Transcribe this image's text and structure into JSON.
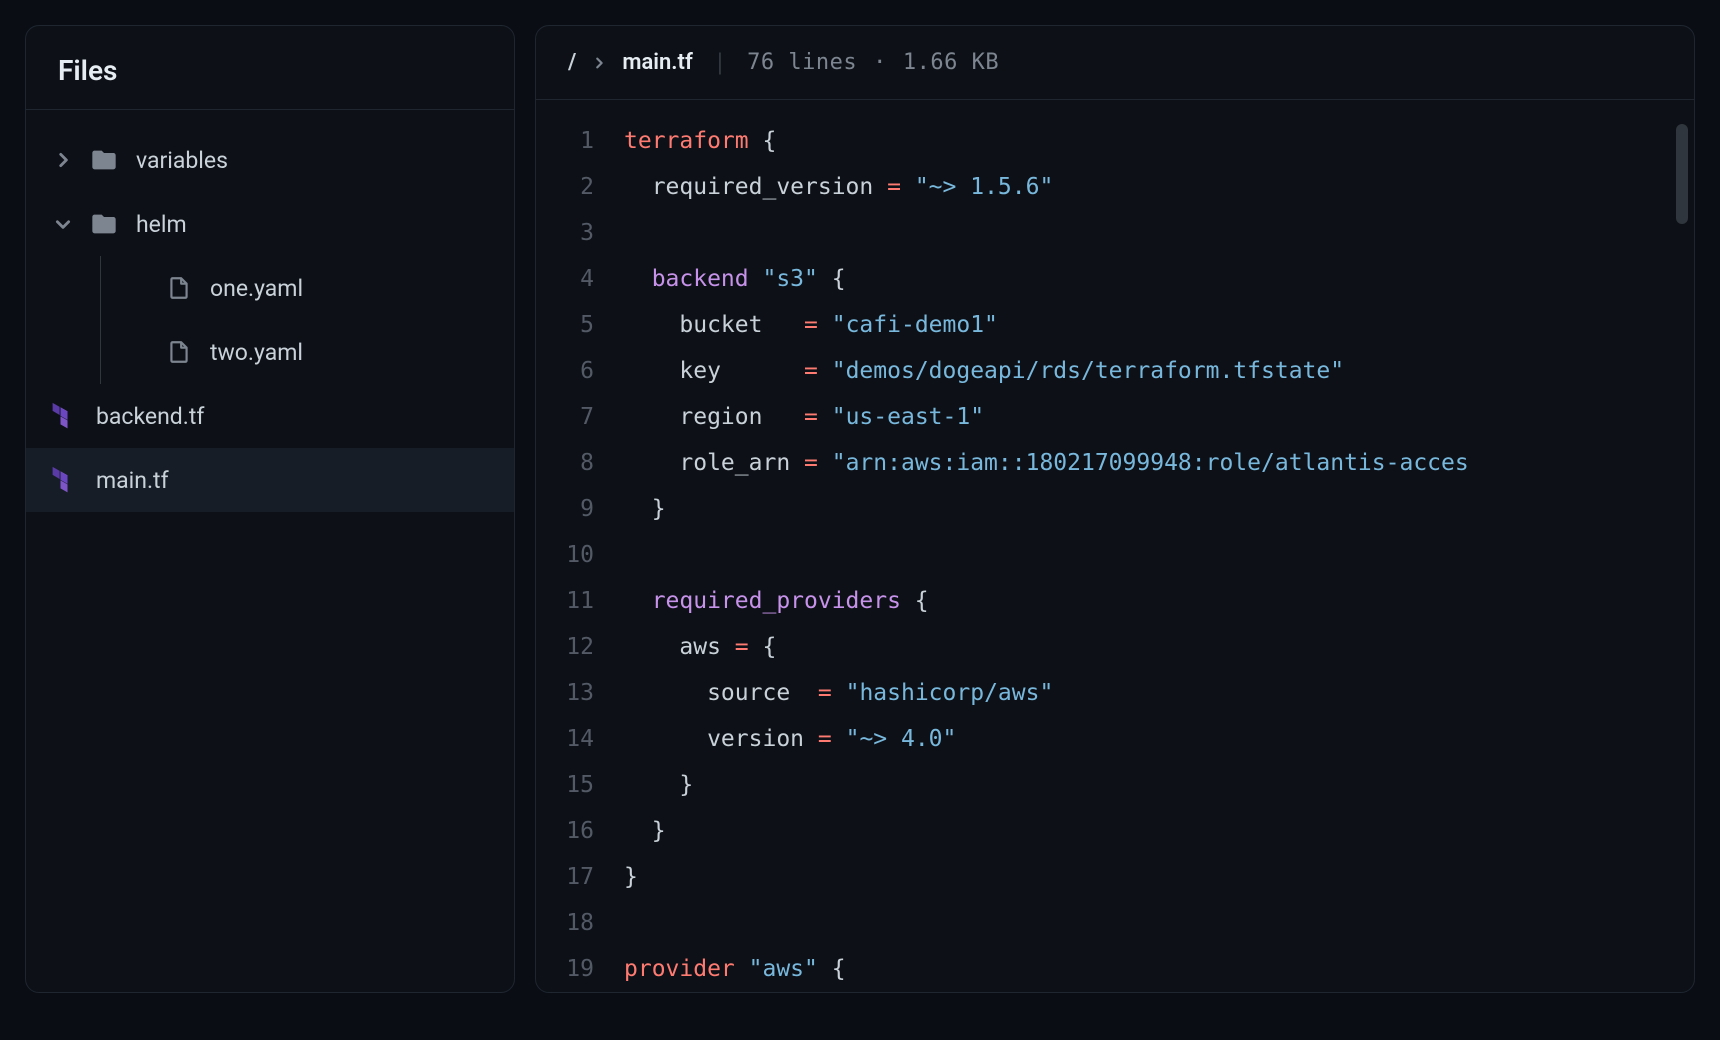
{
  "sidebar": {
    "title": "Files",
    "tree": [
      {
        "type": "folder",
        "name": "variables",
        "expanded": false,
        "indent": 0
      },
      {
        "type": "folder",
        "name": "helm",
        "expanded": true,
        "indent": 0
      },
      {
        "type": "file",
        "name": "one.yaml",
        "icon": "file",
        "indent": 2
      },
      {
        "type": "file",
        "name": "two.yaml",
        "icon": "file",
        "indent": 2
      },
      {
        "type": "file",
        "name": "backend.tf",
        "icon": "terraform",
        "indent": 0,
        "noChevron": true
      },
      {
        "type": "file",
        "name": "main.tf",
        "icon": "terraform",
        "indent": 0,
        "noChevron": true,
        "selected": true
      }
    ]
  },
  "editor": {
    "breadcrumb": {
      "root": "/",
      "file": "main.tf"
    },
    "meta": {
      "lines": "76 lines",
      "size": "1.66 KB"
    },
    "code": [
      [
        {
          "t": "kw",
          "v": "terraform"
        },
        {
          "t": "punc",
          "v": " {"
        }
      ],
      [
        {
          "t": "prop",
          "v": "  required_version "
        },
        {
          "t": "op",
          "v": "="
        },
        {
          "t": "punc",
          "v": " "
        },
        {
          "t": "str",
          "v": "\"~> 1.5.6\""
        }
      ],
      [],
      [
        {
          "t": "block",
          "v": "  backend "
        },
        {
          "t": "str",
          "v": "\"s3\""
        },
        {
          "t": "punc",
          "v": " {"
        }
      ],
      [
        {
          "t": "prop",
          "v": "    bucket   "
        },
        {
          "t": "op",
          "v": "="
        },
        {
          "t": "punc",
          "v": " "
        },
        {
          "t": "str",
          "v": "\"cafi-demo1\""
        }
      ],
      [
        {
          "t": "prop",
          "v": "    key      "
        },
        {
          "t": "op",
          "v": "="
        },
        {
          "t": "punc",
          "v": " "
        },
        {
          "t": "str",
          "v": "\"demos/dogeapi/rds/terraform.tfstate\""
        }
      ],
      [
        {
          "t": "prop",
          "v": "    region   "
        },
        {
          "t": "op",
          "v": "="
        },
        {
          "t": "punc",
          "v": " "
        },
        {
          "t": "str",
          "v": "\"us-east-1\""
        }
      ],
      [
        {
          "t": "prop",
          "v": "    role_arn "
        },
        {
          "t": "op",
          "v": "="
        },
        {
          "t": "punc",
          "v": " "
        },
        {
          "t": "str",
          "v": "\"arn:aws:iam::180217099948:role/atlantis-acces"
        }
      ],
      [
        {
          "t": "punc",
          "v": "  }"
        }
      ],
      [],
      [
        {
          "t": "block",
          "v": "  required_providers "
        },
        {
          "t": "punc",
          "v": "{"
        }
      ],
      [
        {
          "t": "prop",
          "v": "    aws "
        },
        {
          "t": "op",
          "v": "="
        },
        {
          "t": "punc",
          "v": " {"
        }
      ],
      [
        {
          "t": "prop",
          "v": "      source  "
        },
        {
          "t": "op",
          "v": "="
        },
        {
          "t": "punc",
          "v": " "
        },
        {
          "t": "str",
          "v": "\"hashicorp/aws\""
        }
      ],
      [
        {
          "t": "prop",
          "v": "      version "
        },
        {
          "t": "op",
          "v": "="
        },
        {
          "t": "punc",
          "v": " "
        },
        {
          "t": "str",
          "v": "\"~> 4.0\""
        }
      ],
      [
        {
          "t": "punc",
          "v": "    }"
        }
      ],
      [
        {
          "t": "punc",
          "v": "  }"
        }
      ],
      [
        {
          "t": "punc",
          "v": "}"
        }
      ],
      [],
      [
        {
          "t": "kw",
          "v": "provider "
        },
        {
          "t": "str",
          "v": "\"aws\""
        },
        {
          "t": "punc",
          "v": " {"
        }
      ]
    ]
  }
}
